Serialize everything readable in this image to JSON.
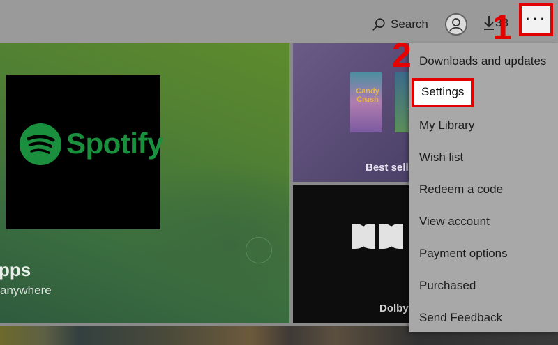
{
  "header": {
    "search_label": "Search",
    "downloads_count": "38",
    "more_label": "···"
  },
  "annotations": {
    "step1": "1",
    "step2": "2"
  },
  "hero": {
    "app_name": "Spotify",
    "title_partial": "pps",
    "subtitle_partial": "anywhere"
  },
  "tiles": {
    "games_label": "Best sellers",
    "candy_title": "Candy Crush",
    "dolby_label": "Dolby"
  },
  "menu": {
    "items": [
      "Downloads and updates",
      "Settings",
      "My Library",
      "Wish list",
      "Redeem a code",
      "View account",
      "Payment options",
      "Purchased",
      "Send Feedback"
    ]
  },
  "colors": {
    "highlight_red": "#e30000",
    "spotify_green": "#1a8f3e"
  }
}
